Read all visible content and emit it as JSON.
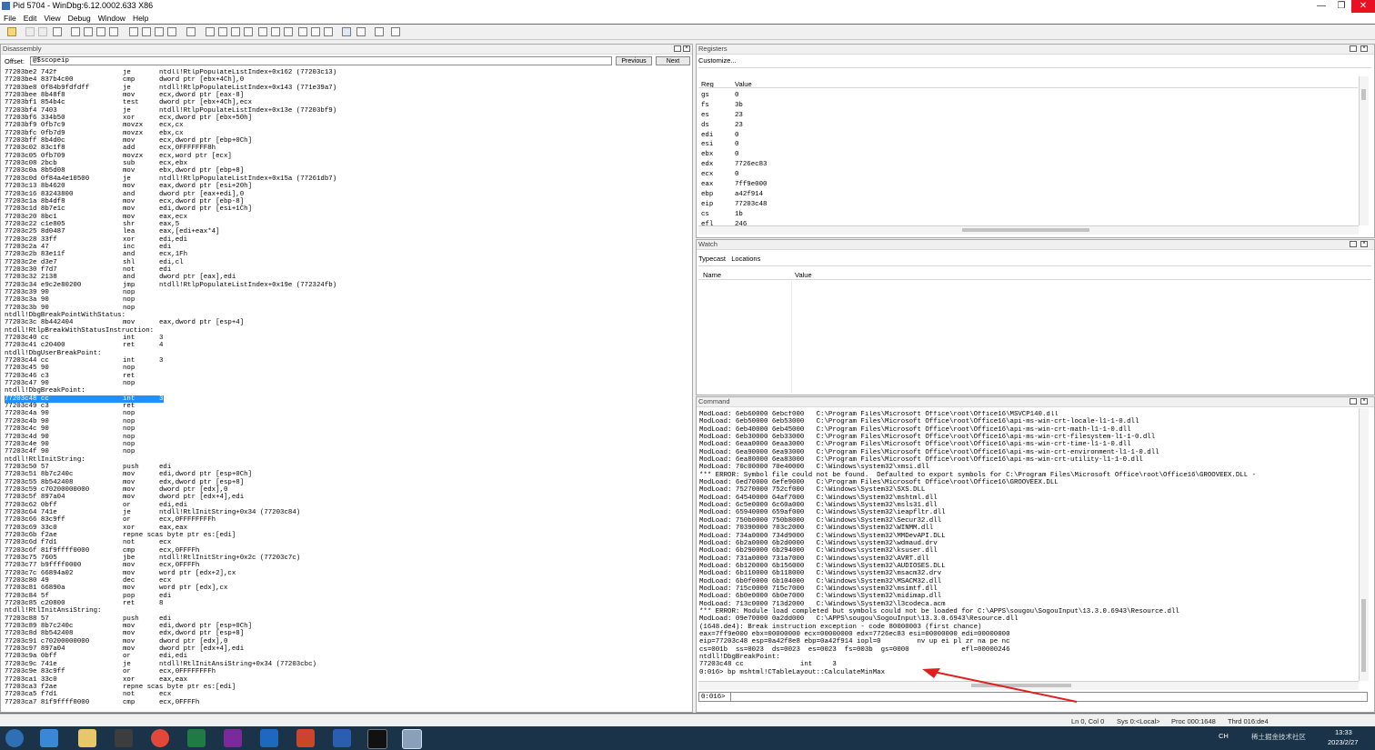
{
  "window": {
    "title": "Pid 5704 - WinDbg:6.12.0002.633 X86",
    "minimize": "—",
    "maximize": "❐",
    "close": "✕"
  },
  "menu": [
    "File",
    "Edit",
    "View",
    "Debug",
    "Window",
    "Help"
  ],
  "disassembly": {
    "title": "Disassembly",
    "offset_label": "Offset:",
    "offset_value": "@$scopeip",
    "previous": "Previous",
    "next": "Next",
    "lines": [
      [
        "77203be2 742f",
        "je",
        "ntdll!RtlpPopulateListIndex+0x162 (77203c13)"
      ],
      [
        "77203be4 837b4c00",
        "cmp",
        "dword ptr [ebx+4Ch],0"
      ],
      [
        "77203be8 0f84b9fdfdff",
        "je",
        "ntdll!RtlpPopulateListIndex+0x143 (771e39a7)"
      ],
      [
        "77203bee 8b48f8",
        "mov",
        "ecx,dword ptr [eax-8]"
      ],
      [
        "77203bf1 854b4c",
        "test",
        "dword ptr [ebx+4Ch],ecx"
      ],
      [
        "77203bf4 7403",
        "je",
        "ntdll!RtlpPopulateListIndex+0x13e (77203bf9)"
      ],
      [
        "77203bf6 334b50",
        "xor",
        "ecx,dword ptr [ebx+50h]"
      ],
      [
        "77203bf9 0fb7c9",
        "movzx",
        "ecx,cx"
      ],
      [
        "77203bfc 0fb7d9",
        "movzx",
        "ebx,cx"
      ],
      [
        "77203bff 8b4d0c",
        "mov",
        "ecx,dword ptr [ebp+0Ch]"
      ],
      [
        "77203c02 83c1f8",
        "add",
        "ecx,0FFFFFFF8h"
      ],
      [
        "77203c05 0fb709",
        "movzx",
        "ecx,word ptr [ecx]"
      ],
      [
        "77203c08 2bcb",
        "sub",
        "ecx,ebx"
      ],
      [
        "77203c0a 8b5d08",
        "mov",
        "ebx,dword ptr [ebp+8]"
      ],
      [
        "77203c0d 0f84a4e10500",
        "je",
        "ntdll!RtlpPopulateListIndex+0x15a (77261db7)"
      ],
      [
        "77203c13 8b4620",
        "mov",
        "eax,dword ptr [esi+20h]"
      ],
      [
        "77203c16 83243800",
        "and",
        "dword ptr [eax+edi],0"
      ],
      [
        "77203c1a 8b4df8",
        "mov",
        "ecx,dword ptr [ebp-8]"
      ],
      [
        "77203c1d 8b7e1c",
        "mov",
        "edi,dword ptr [esi+1Ch]"
      ],
      [
        "77203c20 8bc1",
        "mov",
        "eax,ecx"
      ],
      [
        "77203c22 c1e805",
        "shr",
        "eax,5"
      ],
      [
        "77203c25 8d0487",
        "lea",
        "eax,[edi+eax*4]"
      ],
      [
        "77203c28 33ff",
        "xor",
        "edi,edi"
      ],
      [
        "77203c2a 47",
        "inc",
        "edi"
      ],
      [
        "77203c2b 83e11f",
        "and",
        "ecx,1Fh"
      ],
      [
        "77203c2e d3e7",
        "shl",
        "edi,cl"
      ],
      [
        "77203c30 f7d7",
        "not",
        "edi"
      ],
      [
        "77203c32 2138",
        "and",
        "dword ptr [eax],edi"
      ],
      [
        "77203c34 e9c2e80200",
        "jmp",
        "ntdll!RtlpPopulateListIndex+0x19e (772324fb)"
      ],
      [
        "77203c39 90",
        "nop",
        ""
      ],
      [
        "77203c3a 90",
        "nop",
        ""
      ],
      [
        "77203c3b 90",
        "nop",
        ""
      ],
      [
        "ntdll!DbgBreakPointWithStatus:",
        "",
        ""
      ],
      [
        "77203c3c 8b442404",
        "mov",
        "eax,dword ptr [esp+4]"
      ],
      [
        "ntdll!RtlpBreakWithStatusInstruction:",
        "",
        ""
      ],
      [
        "77203c40 cc",
        "int",
        "3"
      ],
      [
        "77203c41 c20400",
        "ret",
        "4"
      ],
      [
        "ntdll!DbgUserBreakPoint:",
        "",
        ""
      ],
      [
        "77203c44 cc",
        "int",
        "3"
      ],
      [
        "77203c45 90",
        "nop",
        ""
      ],
      [
        "77203c46 c3",
        "ret",
        ""
      ],
      [
        "77203c47 90",
        "nop",
        ""
      ],
      [
        "ntdll!DbgBreakPoint:",
        "",
        ""
      ],
      [
        "77203c48 cc",
        "int",
        "3"
      ],
      [
        "77203c49 c3",
        "ret",
        ""
      ],
      [
        "77203c4a 90",
        "nop",
        ""
      ],
      [
        "77203c4b 90",
        "nop",
        ""
      ],
      [
        "77203c4c 90",
        "nop",
        ""
      ],
      [
        "77203c4d 90",
        "nop",
        ""
      ],
      [
        "77203c4e 90",
        "nop",
        ""
      ],
      [
        "77203c4f 90",
        "nop",
        ""
      ],
      [
        "ntdll!RtlInitString:",
        "",
        ""
      ],
      [
        "77203c50 57",
        "push",
        "edi"
      ],
      [
        "77203c51 8b7c240c",
        "mov",
        "edi,dword ptr [esp+0Ch]"
      ],
      [
        "77203c55 8b542408",
        "mov",
        "edx,dword ptr [esp+8]"
      ],
      [
        "77203c59 c70200000000",
        "mov",
        "dword ptr [edx],0"
      ],
      [
        "77203c5f 897a04",
        "mov",
        "dword ptr [edx+4],edi"
      ],
      [
        "77203c62 0bff",
        "or",
        "edi,edi"
      ],
      [
        "77203c64 741e",
        "je",
        "ntdll!RtlInitString+0x34 (77203c84)"
      ],
      [
        "77203c66 83c9ff",
        "or",
        "ecx,0FFFFFFFFh"
      ],
      [
        "77203c69 33c0",
        "xor",
        "eax,eax"
      ],
      [
        "77203c6b f2ae",
        "repne scas byte ptr es:[edi]",
        ""
      ],
      [
        "77203c6d f7d1",
        "not",
        "ecx"
      ],
      [
        "77203c6f 81f9ffff0000",
        "cmp",
        "ecx,0FFFFh"
      ],
      [
        "77203c75 7605",
        "jbe",
        "ntdll!RtlInitString+0x2c (77203c7c)"
      ],
      [
        "77203c77 b9ffff0000",
        "mov",
        "ecx,0FFFFh"
      ],
      [
        "77203c7c 66894a02",
        "mov",
        "word ptr [edx+2],cx"
      ],
      [
        "77203c80 49",
        "dec",
        "ecx"
      ],
      [
        "77203c81 66890a",
        "mov",
        "word ptr [edx],cx"
      ],
      [
        "77203c84 5f",
        "pop",
        "edi"
      ],
      [
        "77203c85 c20800",
        "ret",
        "8"
      ],
      [
        "ntdll!RtlInitAnsiString:",
        "",
        ""
      ],
      [
        "77203c88 57",
        "push",
        "edi"
      ],
      [
        "77203c89 8b7c240c",
        "mov",
        "edi,dword ptr [esp+0Ch]"
      ],
      [
        "77203c8d 8b542408",
        "mov",
        "edx,dword ptr [esp+8]"
      ],
      [
        "77203c91 c70200000000",
        "mov",
        "dword ptr [edx],0"
      ],
      [
        "77203c97 897a04",
        "mov",
        "dword ptr [edx+4],edi"
      ],
      [
        "77203c9a 0bff",
        "or",
        "edi,edi"
      ],
      [
        "77203c9c 741e",
        "je",
        "ntdll!RtlInitAnsiString+0x34 (77203cbc)"
      ],
      [
        "77203c9e 83c9ff",
        "or",
        "ecx,0FFFFFFFFh"
      ],
      [
        "77203ca1 33c0",
        "xor",
        "eax,eax"
      ],
      [
        "77203ca3 f2ae",
        "repne scas byte ptr es:[edi]",
        ""
      ],
      [
        "77203ca5 f7d1",
        "not",
        "ecx"
      ],
      [
        "77203ca7 81f9ffff0000",
        "cmp",
        "ecx,0FFFFh"
      ]
    ]
  },
  "registers": {
    "title": "Registers",
    "customize": "Customize...",
    "col_reg": "Reg",
    "col_value": "Value",
    "rows": [
      [
        "gs",
        "0"
      ],
      [
        "fs",
        "3b"
      ],
      [
        "es",
        "23"
      ],
      [
        "ds",
        "23"
      ],
      [
        "edi",
        "0"
      ],
      [
        "esi",
        "0"
      ],
      [
        "ebx",
        "0"
      ],
      [
        "edx",
        "7726ec83"
      ],
      [
        "ecx",
        "0"
      ],
      [
        "eax",
        "7ff9e000"
      ],
      [
        "ebp",
        "a42f914"
      ],
      [
        "eip",
        "77203c48"
      ],
      [
        "cs",
        "1b"
      ],
      [
        "efl",
        "246"
      ]
    ]
  },
  "watch": {
    "title": "Watch",
    "typecast": "Typecast",
    "locations": "Locations",
    "col_name": "Name",
    "col_value": "Value"
  },
  "command": {
    "title": "Command",
    "lines": [
      "ModLoad: 6eb60000 6ebcf000   C:\\Program Files\\Microsoft Office\\root\\Office16\\MSVCP140.dll",
      "ModLoad: 6eb50000 6eb53000   C:\\Program Files\\Microsoft Office\\root\\Office16\\api-ms-win-crt-locale-l1-1-0.dll",
      "ModLoad: 6eb40000 6eb45000   C:\\Program Files\\Microsoft Office\\root\\Office16\\api-ms-win-crt-math-l1-1-0.dll",
      "ModLoad: 6eb30000 6eb33000   C:\\Program Files\\Microsoft Office\\root\\Office16\\api-ms-win-crt-filesystem-l1-1-0.dll",
      "ModLoad: 6eaa0000 6eaa3000   C:\\Program Files\\Microsoft Office\\root\\Office16\\api-ms-win-crt-time-l1-1-0.dll",
      "ModLoad: 6ea90000 6ea93000   C:\\Program Files\\Microsoft Office\\root\\Office16\\api-ms-win-crt-environment-l1-1-0.dll",
      "ModLoad: 6ea80000 6ea83000   C:\\Program Files\\Microsoft Office\\root\\Office16\\api-ms-win-crt-utility-l1-1-0.dll",
      "ModLoad: 70c00000 70e40000   C:\\Windows\\system32\\xmsi.dll",
      "*** ERROR: Symbol file could not be found.  Defaulted to export symbols for C:\\Program Files\\Microsoft Office\\root\\Office16\\GROOVEEX.DLL -",
      "ModLoad: 6ed70000 6efe9000   C:\\Program Files\\Microsoft Office\\root\\Office16\\GROOVEEX.DLL",
      "ModLoad: 75270000 752cf000   C:\\Windows\\System32\\SXS.DLL",
      "ModLoad: 64540000 64af7000   C:\\Windows\\System32\\mshtml.dll",
      "ModLoad: 6c5e0000 6c60a000   C:\\Windows\\System32\\msls31.dll",
      "ModLoad: 65940000 659af000   C:\\Windows\\System32\\ieapfltr.dll",
      "ModLoad: 750b0000 750b8000   C:\\Windows\\System32\\Secur32.dll",
      "ModLoad: 70390000 703c2000   C:\\Windows\\System32\\WINMM.dll",
      "ModLoad: 734a0000 734d9000   C:\\Windows\\System32\\MMDevAPI.DLL",
      "ModLoad: 6b2a0000 6b2d0000   C:\\Windows\\system32\\wdmaud.drv",
      "ModLoad: 6b290000 6b294000   C:\\Windows\\system32\\ksuser.dll",
      "ModLoad: 731a0000 731a7000   C:\\Windows\\system32\\AVRT.dll",
      "ModLoad: 6b120000 6b156000   C:\\Windows\\System32\\AUDIOSES.DLL",
      "ModLoad: 6b110000 6b118000   C:\\Windows\\system32\\msacm32.drv",
      "ModLoad: 6b0f0000 6b104000   C:\\Windows\\System32\\MSACM32.dll",
      "ModLoad: 715c0000 715c7000   C:\\Windows\\system32\\msimtf.dll",
      "ModLoad: 6b0e0000 6b0e7000   C:\\Windows\\System32\\midimap.dll",
      "ModLoad: 713c0000 713d2000   C:\\Windows\\System32\\l3codeca.acm",
      "*** ERROR: Module load completed but symbols could not be loaded for C:\\APPS\\sougou\\SogouInput\\13.3.0.6943\\Resource.dll",
      "ModLoad: 09e70000 0a2dd000   C:\\APPS\\sougou\\SogouInput\\13.3.0.6943\\Resource.dll",
      "(1648.de4): Break instruction exception - code 80000003 (first chance)",
      "eax=7ff9e000 ebx=00000000 ecx=00000000 edx=7726ec83 esi=00000000 edi=00000000",
      "eip=77203c48 esp=0a42f8e8 ebp=0a42f914 iopl=0         nv up ei pl zr na pe nc",
      "cs=001b  ss=0023  ds=0023  es=0023  fs=003b  gs=0000             efl=00000246",
      "ntdll!DbgBreakPoint:",
      "77203c48 cc              int     3",
      "0:016> bp mshtml!CTableLayout::CalculateMinMax"
    ],
    "prompt": "0:016>",
    "input_value": ""
  },
  "statusbar": {
    "pos": "Ln 0, Col 0",
    "sys": "Sys 0:<Local>",
    "proc": "Proc 000:1648",
    "thrd": "Thrd 016:de4"
  },
  "taskbar": {
    "time": "13:33",
    "date": "2023/2/27",
    "ime": "CH",
    "watermark": "稀土掘金技术社区"
  },
  "colors": {
    "accent": "#1e90ff",
    "arrow": "#e02020",
    "taskbar": "#1b3348"
  }
}
